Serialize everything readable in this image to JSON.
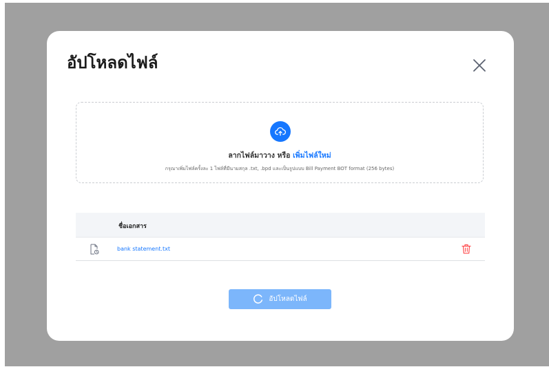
{
  "modal": {
    "title": "อัปโหลดไฟล์"
  },
  "dropzone": {
    "text": "ลากไฟล์มาวาง หรือ",
    "link": "เพิ่มไฟล์ใหม่",
    "hint": "กรุณาเพิ่มไฟล์ครั้งละ 1 ไฟล์ที่มีนามสกุล .txt, .bpd และเป็นรูปแบบ Bill Payment BOT format (256 bytes)"
  },
  "table": {
    "headers": [
      "ชื่อเอกสาร"
    ],
    "rows": [
      {
        "file_name": "bank statement.txt"
      }
    ]
  },
  "footer": {
    "upload_label": "อัปโหลดไฟล์"
  },
  "icons": {
    "close": "close-icon",
    "upload": "cloud-upload-icon",
    "file": "file-icon",
    "delete": "trash-icon",
    "spinner": "loading-spinner-icon"
  },
  "colors": {
    "primary": "#1677ff",
    "primary_disabled": "#7cb6fb",
    "danger": "#ff4d4f",
    "backdrop": "#a0a0a0",
    "table_header_bg": "#f3f5f8"
  }
}
